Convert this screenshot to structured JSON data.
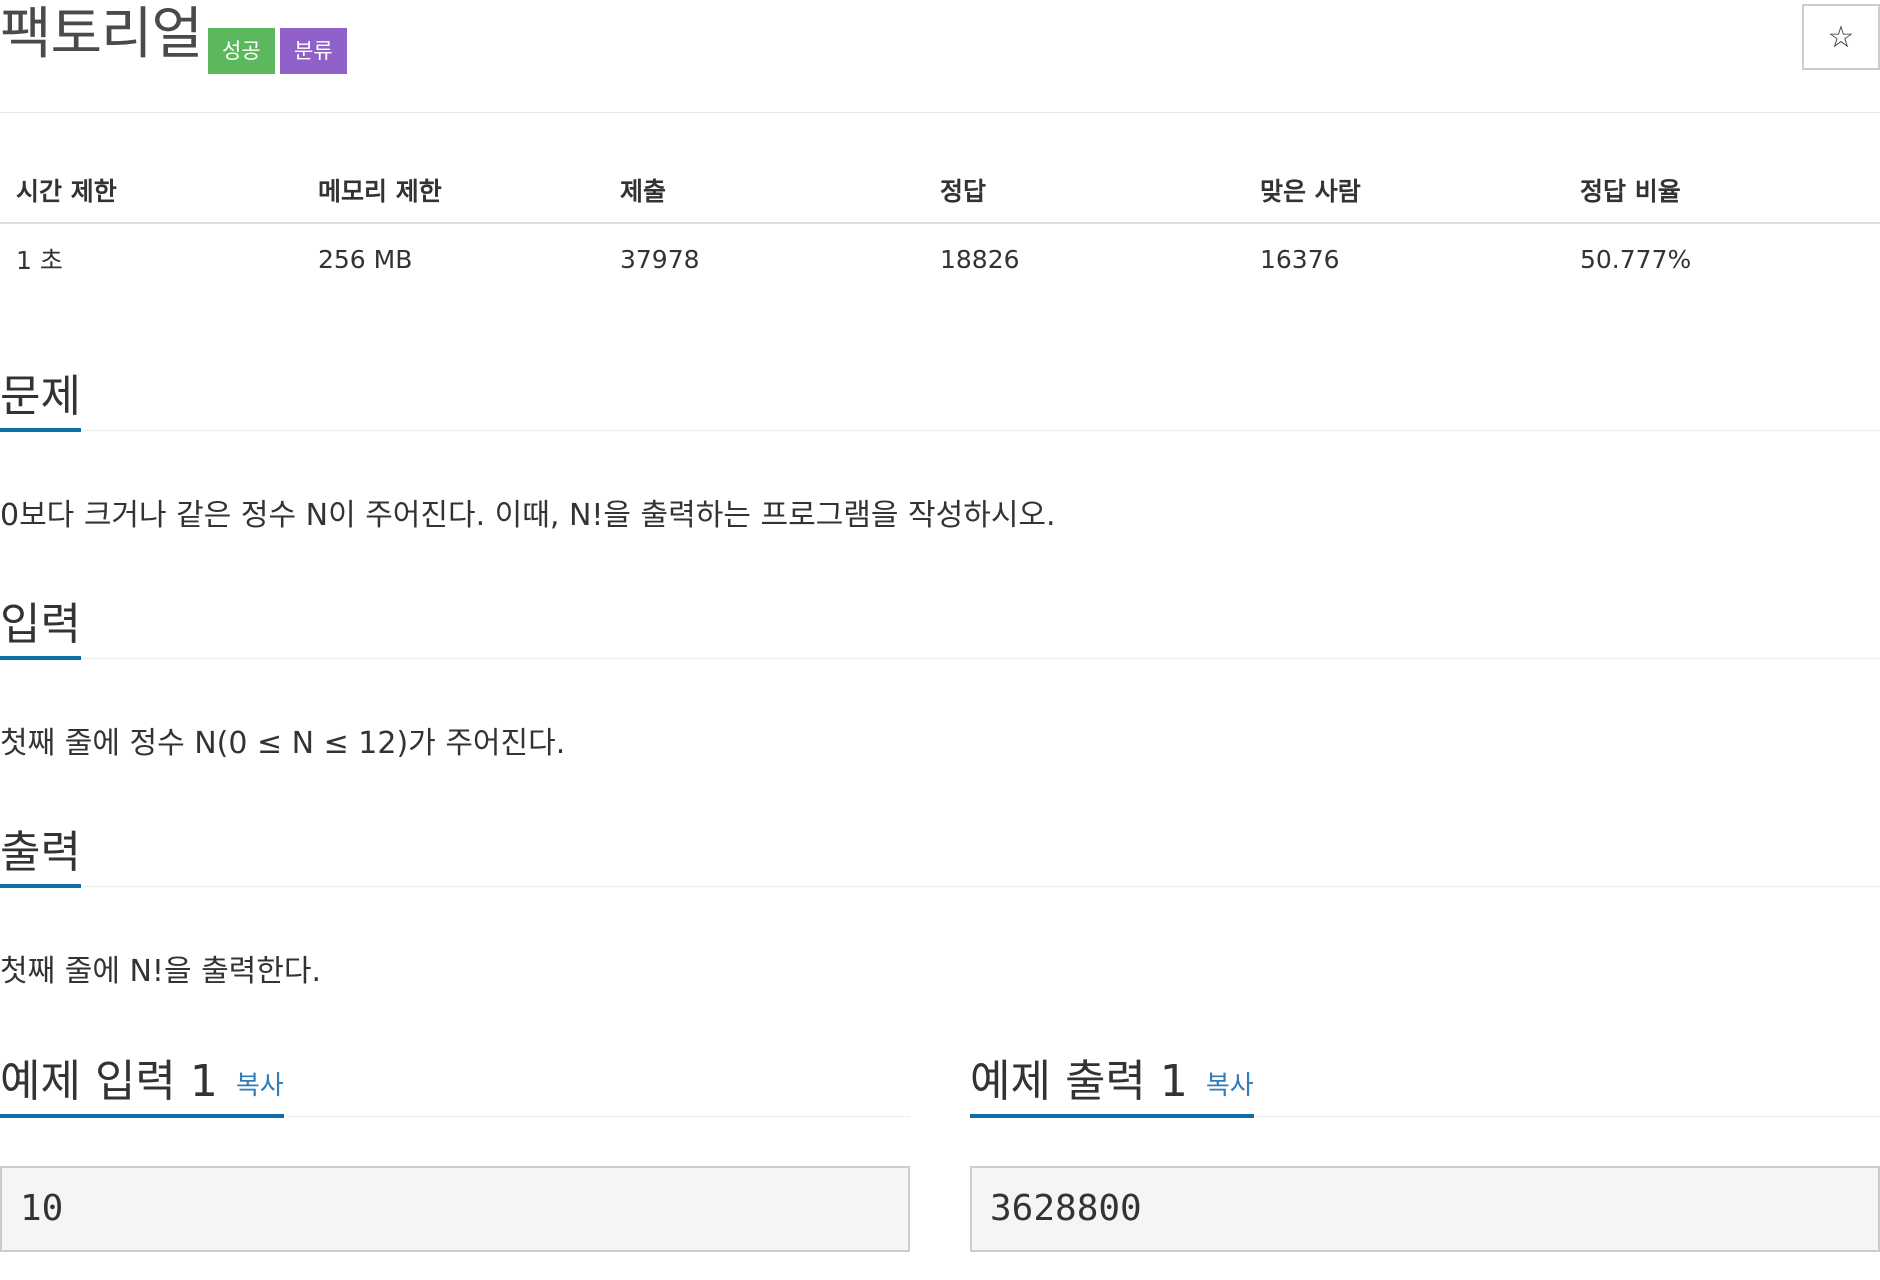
{
  "problem": {
    "title": "팩토리얼",
    "labels": {
      "success": "성공",
      "classification": "분류"
    },
    "star_icon": "☆"
  },
  "info_table": {
    "headers": [
      "시간 제한",
      "메모리 제한",
      "제출",
      "정답",
      "맞은 사람",
      "정답 비율"
    ],
    "values": [
      "1 초",
      "256 MB",
      "37978",
      "18826",
      "16376",
      "50.777%"
    ]
  },
  "sections": {
    "description": {
      "title": "문제",
      "text": "0보다 크거나 같은 정수 N이 주어진다. 이때, N!을 출력하는 프로그램을 작성하시오."
    },
    "input": {
      "title": "입력",
      "text": "첫째 줄에 정수 N(0 ≤ N ≤ 12)가 주어진다."
    },
    "output": {
      "title": "출력",
      "text": "첫째 줄에 N!을 출력한다."
    }
  },
  "samples": {
    "input": {
      "title": "예제 입력 1",
      "copy_label": "복사",
      "value": "10"
    },
    "output": {
      "title": "예제 출력 1",
      "copy_label": "복사",
      "value": "3628800"
    }
  },
  "colors": {
    "success_label": "#5cb85c",
    "class_label": "#9062c9",
    "headline_underline": "#0d6ea8",
    "link": "#337ab7"
  }
}
